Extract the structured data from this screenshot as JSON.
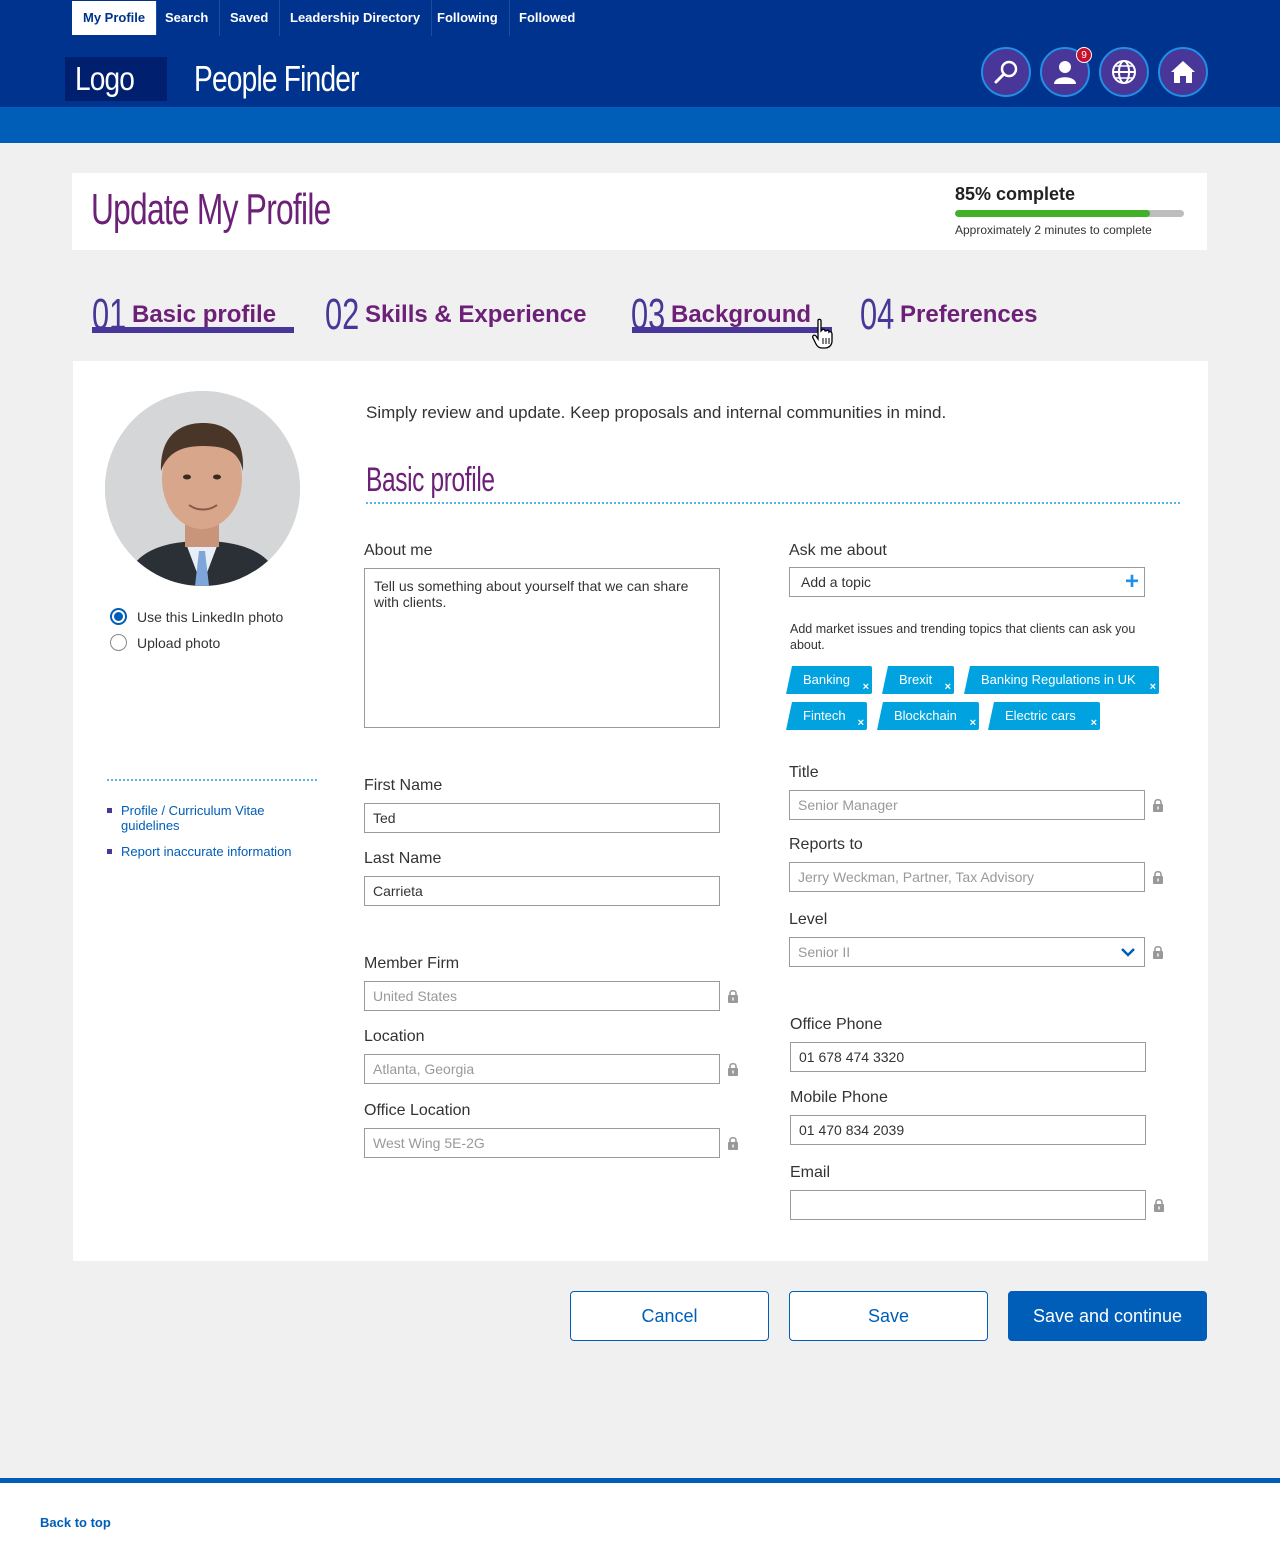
{
  "header": {
    "logo": "Logo",
    "app_title": "People Finder",
    "notification_count": "9",
    "icons": [
      "search-icon",
      "user-icon",
      "globe-icon",
      "home-icon"
    ]
  },
  "nav": {
    "items": [
      "My Profile",
      "Search",
      "Saved",
      "Leadership Directory",
      "Following",
      "Followed"
    ],
    "active": "My Profile"
  },
  "title_panel": {
    "title": "Update My Profile",
    "progress_label": "85% complete",
    "progress_value": 0.85,
    "progress_sub": "Approximately 2 minutes to complete"
  },
  "steps": [
    {
      "num": "01",
      "label": "Basic profile"
    },
    {
      "num": "02",
      "label": "Skills & Experience"
    },
    {
      "num": "03",
      "label": "Background"
    },
    {
      "num": "04",
      "label": "Preferences"
    }
  ],
  "sidebar": {
    "photo_options": [
      "Use this LinkedIn photo",
      "Upload photo"
    ],
    "selected_photo_option": "Use this LinkedIn photo",
    "links": [
      "Profile / Curriculum Vitae guidelines",
      "Report inaccurate information"
    ]
  },
  "form": {
    "intro": "Simply review and update. Keep proposals and internal communities in mind.",
    "section_title": "Basic profile",
    "about_me": {
      "label": "About me",
      "placeholder": "Tell us something about yourself that we can share with clients."
    },
    "ask_me_about": {
      "label": "Ask me about",
      "placeholder": "Add a topic",
      "helper": "Add market issues and trending topics that clients can ask you about.",
      "tags": [
        "Banking",
        "Brexit",
        "Banking Regulations in UK",
        "Fintech",
        "Blockchain",
        "Electric cars"
      ]
    },
    "first_name": {
      "label": "First Name",
      "value": "Ted"
    },
    "last_name": {
      "label": "Last Name",
      "value": "Carrieta"
    },
    "member_firm": {
      "label": "Member Firm",
      "value": "United States"
    },
    "location": {
      "label": "Location",
      "value": "Atlanta, Georgia"
    },
    "office_location": {
      "label": "Office Location",
      "value": "West Wing 5E-2G"
    },
    "title": {
      "label": "Title",
      "value": "Senior Manager"
    },
    "reports_to": {
      "label": "Reports to",
      "value": "Jerry Weckman, Partner, Tax Advisory"
    },
    "level": {
      "label": "Level",
      "value": "Senior II"
    },
    "office_phone": {
      "label": "Office Phone",
      "value": "01 678 474 3320"
    },
    "mobile_phone": {
      "label": "Mobile Phone",
      "value": "01 470 834 2039"
    },
    "email": {
      "label": "Email",
      "value": ""
    }
  },
  "actions": {
    "cancel": "Cancel",
    "save": "Save",
    "save_continue": "Save and continue"
  },
  "footer": {
    "back_to_top": "Back to top"
  },
  "colors": {
    "navy": "#00338d",
    "blue": "#005eb8",
    "purple": "#6d2077",
    "violet": "#483698",
    "cyan": "#00a3e0",
    "green": "#43b02a"
  }
}
